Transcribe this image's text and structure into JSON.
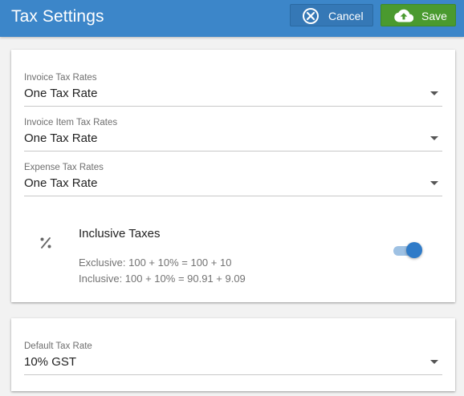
{
  "header": {
    "title": "Tax Settings",
    "cancel_label": "Cancel",
    "save_label": "Save",
    "cancel_icon": "close-circle-icon",
    "save_icon": "cloud-upload-icon"
  },
  "tax_rates": {
    "invoice_tax_rates": {
      "label": "Invoice Tax Rates",
      "value": "One Tax Rate"
    },
    "invoice_item_tax_rates": {
      "label": "Invoice Item Tax Rates",
      "value": "One Tax Rate"
    },
    "expense_tax_rates": {
      "label": "Expense Tax Rates",
      "value": "One Tax Rate"
    }
  },
  "inclusive_taxes": {
    "icon": "percent-icon",
    "title": "Inclusive Taxes",
    "exclusive_example": "Exclusive: 100 + 10% = 100 + 10",
    "inclusive_example": "Inclusive: 100 + 10% = 90.91 + 9.09",
    "enabled": true
  },
  "default_tax": {
    "label": "Default Tax Rate",
    "value": "10% GST"
  },
  "colors": {
    "header": "#3c86c9",
    "cancel_button": "#3578b6",
    "save_button": "#4a9a2f",
    "toggle_on": "#2f7bc8"
  }
}
